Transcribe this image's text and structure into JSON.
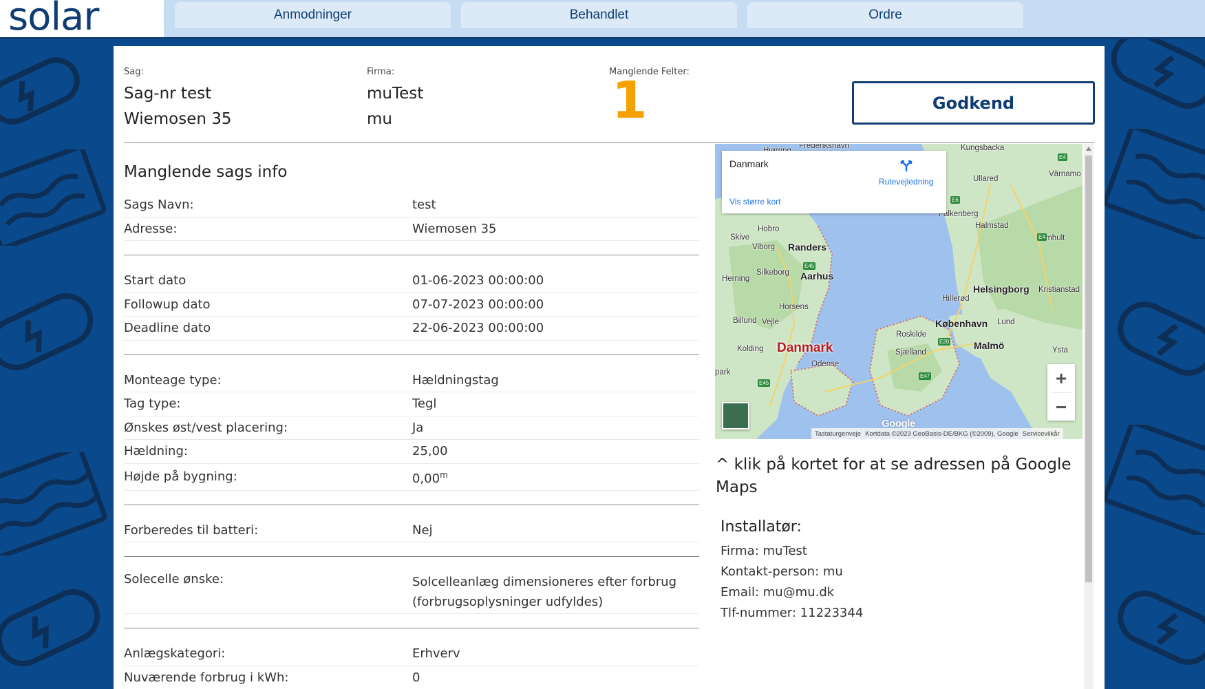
{
  "brand": {
    "logo": "solar",
    "accent": "#0f3d73",
    "background": "#0a4a8c",
    "warning": "#f5a100"
  },
  "nav": {
    "tabs": [
      {
        "label": "Anmodninger"
      },
      {
        "label": "Behandlet"
      },
      {
        "label": "Ordre"
      }
    ]
  },
  "header": {
    "sag_label": "Sag:",
    "sag_nr": "Sag-nr test",
    "sag_address": "Wiemosen 35",
    "firma_label": "Firma:",
    "firma_name": "muTest",
    "firma_user": "mu",
    "missing_label": "Manglende Felter:",
    "missing_count": "1",
    "approve_label": "Godkend"
  },
  "info": {
    "title": "Manglende sags info",
    "groups": [
      [
        {
          "key": "Sags Navn:",
          "value": "test"
        },
        {
          "key": "Adresse:",
          "value": "Wiemosen 35"
        }
      ],
      [
        {
          "key": "Start dato",
          "value": "01-06-2023 00:00:00"
        },
        {
          "key": "Followup dato",
          "value": "07-07-2023 00:00:00"
        },
        {
          "key": "Deadline dato",
          "value": "22-06-2023 00:00:00"
        }
      ],
      [
        {
          "key": "Monteage type:",
          "value": "Hældningstag"
        },
        {
          "key": "Tag type:",
          "value": "Tegl"
        },
        {
          "key": "Ønskes øst/vest placering:",
          "value": "Ja"
        },
        {
          "key": "Hældning:",
          "value": "25,00"
        },
        {
          "key": "Højde på bygning:",
          "value": "0,00",
          "unit": "m"
        }
      ],
      [
        {
          "key": "Forberedes til batteri:",
          "value": "Nej"
        }
      ],
      [
        {
          "key": "Solecelle ønske:",
          "value": "Solcelleanlæg dimensioneres efter forbrug (forbrugsoplysninger udfyldes)"
        }
      ],
      [
        {
          "key": "Anlægskategori:",
          "value": "Erhverv"
        },
        {
          "key": "Nuværende forbrug i kWh:",
          "value": "0"
        }
      ]
    ]
  },
  "map": {
    "card_name": "Danmark",
    "route_label": "Rutevejledning",
    "larger_map": "Vis større kort",
    "zoom_in": "+",
    "zoom_out": "−",
    "google": "Google",
    "footer": {
      "shortcuts": "Tastaturgenveje",
      "mapdata": "Kortdata ©2023 GeoBasis-DE/BKG (©2009), Google",
      "terms": "Servicevilkår"
    },
    "labels": {
      "frederikshavn": "Frederikshavn",
      "kungsbacka": "Kungsbacka",
      "varnamo": "Värnamo",
      "ullared": "Ullared",
      "falkenberg": "Falkenberg",
      "halmstad": "Halmstad",
      "almhult": "Älmhult",
      "hobro": "Hobro",
      "skive": "Skive",
      "viborg": "Viborg",
      "randers": "Randers",
      "silkeborg": "Silkeborg",
      "aarhus": "Aarhus",
      "herning": "Herning",
      "helsingborg": "Helsingborg",
      "kristianstad": "Kristianstad",
      "hillerod": "Hillerød",
      "horsens": "Horsens",
      "billund": "Billund",
      "vejle": "Vejle",
      "kobenhavn": "København",
      "lund": "Lund",
      "roskilde": "Roskilde",
      "kolding": "Kolding",
      "danmark": "Danmark",
      "sjaelland": "Sjælland",
      "malmo": "Malmö",
      "ysta": "Ysta",
      "odense": "Odense",
      "park": "park",
      "hjorring": "Hjørring"
    }
  },
  "map_note": "^ klik på kortet for at se adressen på Google Maps",
  "installer": {
    "title": "Installatør:",
    "firma": "Firma: muTest",
    "contact": "Kontakt-person: mu",
    "email": "Email: mu@mu.dk",
    "phone": "Tlf-nummer: 11223344"
  }
}
